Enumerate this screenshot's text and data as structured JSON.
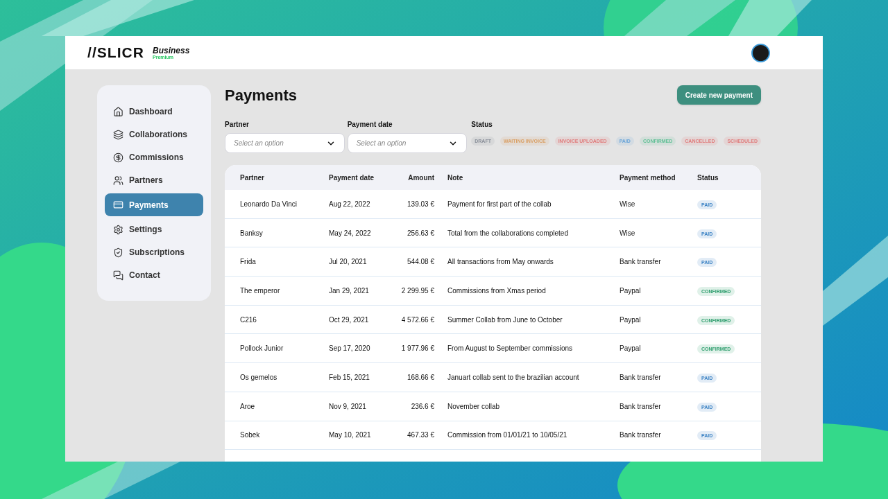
{
  "header": {
    "logo": "//SLICR",
    "plan": "Business",
    "tier": "Premium"
  },
  "sidebar": {
    "items": [
      {
        "label": "Dashboard",
        "selected": false
      },
      {
        "label": "Collaborations",
        "selected": false
      },
      {
        "label": "Commissions",
        "selected": false
      },
      {
        "label": "Partners",
        "selected": false
      },
      {
        "label": "Payments",
        "selected": true
      },
      {
        "label": "Settings",
        "selected": false
      },
      {
        "label": "Subscriptions",
        "selected": false
      },
      {
        "label": "Contact",
        "selected": false
      }
    ]
  },
  "page": {
    "title": "Payments",
    "create_button": "Create new payment"
  },
  "filters": [
    {
      "label": "Partner",
      "placeholder": "Select an option"
    },
    {
      "label": "Payment date",
      "placeholder": "Select an option"
    }
  ],
  "status_filter": {
    "label": "Status",
    "chips": [
      {
        "label": "DRAFT",
        "color": "#8a8f99"
      },
      {
        "label": "WAITING INVOICE",
        "color": "#d9a066"
      },
      {
        "label": "INVOICE UPLOADED",
        "color": "#e07b7b"
      },
      {
        "label": "PAID",
        "color": "#6aa5d8"
      },
      {
        "label": "CONFIRMED",
        "color": "#5fbf95"
      },
      {
        "label": "CANCELLED",
        "color": "#e07b7b"
      },
      {
        "label": "SCHEDULED",
        "color": "#e07b7b"
      }
    ]
  },
  "table": {
    "columns": [
      "Partner",
      "Payment date",
      "Amount",
      "Note",
      "Payment method",
      "Status"
    ],
    "rows": [
      {
        "partner": "Leonardo Da Vinci",
        "date": "Aug 22, 2022",
        "amount": "139.03 €",
        "note": "Payment for first part of the collab",
        "method": "Wise",
        "status": "PAID",
        "color": "#3b82c4"
      },
      {
        "partner": "Banksy",
        "date": "May 24, 2022",
        "amount": "256.63 €",
        "note": "Total from the collaborations completed",
        "method": "Wise",
        "status": "PAID",
        "color": "#3b82c4"
      },
      {
        "partner": "Frida",
        "date": "Jul 20, 2021",
        "amount": "544.08 €",
        "note": "All transactions from May onwards",
        "method": "Bank transfer",
        "status": "PAID",
        "color": "#3b82c4"
      },
      {
        "partner": "The emperor",
        "date": "Jan 29, 2021",
        "amount": "2 299.95 €",
        "note": "Commissions from Xmas period",
        "method": "Paypal",
        "status": "CONFIRMED",
        "color": "#2f9e6e"
      },
      {
        "partner": "C216",
        "date": "Oct 29, 2021",
        "amount": "4 572.66 €",
        "note": "Summer Collab from June to October",
        "method": "Paypal",
        "status": "CONFIRMED",
        "color": "#2f9e6e"
      },
      {
        "partner": "Pollock Junior",
        "date": "Sep 17, 2020",
        "amount": "1 977.96 €",
        "note": "From August to September commissions",
        "method": "Paypal",
        "status": "CONFIRMED",
        "color": "#2f9e6e"
      },
      {
        "partner": "Os gemelos",
        "date": "Feb 15, 2021",
        "amount": "168.66 €",
        "note": "Januart collab sent to the brazilian account",
        "method": "Bank transfer",
        "status": "PAID",
        "color": "#3b82c4"
      },
      {
        "partner": "Aroe",
        "date": "Nov 9, 2021",
        "amount": "236.6 €",
        "note": "November collab",
        "method": "Bank transfer",
        "status": "PAID",
        "color": "#3b82c4"
      },
      {
        "partner": "Sobek",
        "date": "May 10, 2021",
        "amount": "467.33 €",
        "note": "Commission from 01/01/21 to 10/05/21",
        "method": "Bank transfer",
        "status": "PAID",
        "color": "#3b82c4"
      }
    ]
  }
}
